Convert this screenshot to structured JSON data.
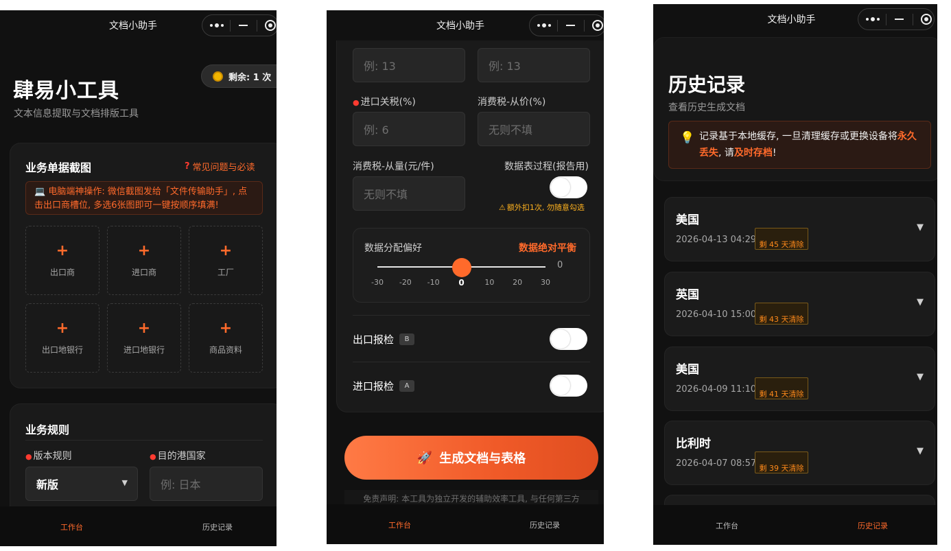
{
  "app": {
    "title": "文档小助手"
  },
  "tabs": {
    "workbench": "工作台",
    "history": "历史记录"
  },
  "workbench": {
    "title": "肆易小工具",
    "subtitle": "文本信息提取与文档排版工具",
    "balance": "剩余: 1 次",
    "capture_section": {
      "title": "业务单据截图",
      "faq": "常见问题与必读",
      "notice": "💻 电脑端神操作: 微信截图发给「文件传输助手」, 点击出口商槽位, 多选6张图即可一键按顺序填满!",
      "slots": [
        "出口商",
        "进口商",
        "工厂",
        "出口地银行",
        "进口地银行",
        "商品资料"
      ]
    },
    "rules_section": {
      "title": "业务规则",
      "version_label": "版本规则",
      "version_value": "新版",
      "port_label": "目的港国家",
      "port_placeholder": "例: 日本"
    }
  },
  "form": {
    "top_placeholder_left": "例: 13",
    "top_placeholder_right": "例: 13",
    "import_duty_label": "进口关税(%)",
    "import_duty_placeholder": "例: 6",
    "consumption_ad_valorem_label": "消费税-从价(%)",
    "consumption_ad_valorem_placeholder": "无则不填",
    "consumption_specific_label": "消费税-从量(元/件)",
    "consumption_specific_placeholder": "无则不填",
    "process_label": "数据表过程(报告用)",
    "process_on": false,
    "process_warning": "额外扣1次, 勿随意勾选",
    "slider": {
      "label": "数据分配偏好",
      "mode": "数据绝对平衡",
      "value": 0,
      "min": -30,
      "max": 30,
      "ticks": [
        "-30",
        "-20",
        "-10",
        "0",
        "10",
        "20",
        "30"
      ],
      "value_text": "0"
    },
    "export_inspection": {
      "label": "出口报检",
      "badge": "B",
      "on": false
    },
    "import_inspection": {
      "label": "进口报检",
      "badge": "A",
      "on": false
    },
    "generate_button": "生成文档与表格",
    "disclaimer": "免责声明: 本工具为独立开发的辅助效率工具, 与任何第三方"
  },
  "history": {
    "title": "历史记录",
    "subtitle": "查看历史生成文档",
    "notice_part1": "记录基于本地缓存, 一旦清理缓存或更换设备将",
    "notice_highlight1": "永久丢失",
    "notice_part2": ", 请",
    "notice_highlight2": "及时存档",
    "notice_part3": "!",
    "records": [
      {
        "country": "美国",
        "date": "2026-04-13 04:29",
        "remaining": "剩 45 天清除"
      },
      {
        "country": "英国",
        "date": "2026-04-10 15:00",
        "remaining": "剩 43 天清除"
      },
      {
        "country": "美国",
        "date": "2026-04-09 11:10",
        "remaining": "剩 41 天清除"
      },
      {
        "country": "比利时",
        "date": "2026-04-07 08:57",
        "remaining": "剩 39 天清除"
      }
    ]
  },
  "colors": {
    "accent": "#ff6a2b",
    "background": "#111111",
    "card": "#1a1a1a",
    "warning": "#ffb21f"
  },
  "icons": [
    "more-dots-icon",
    "minimize-icon",
    "target-icon",
    "coin-icon",
    "question-icon",
    "laptop-icon",
    "plus-icon",
    "chevron-down-icon",
    "warning-icon",
    "rocket-icon",
    "bulb-icon"
  ]
}
